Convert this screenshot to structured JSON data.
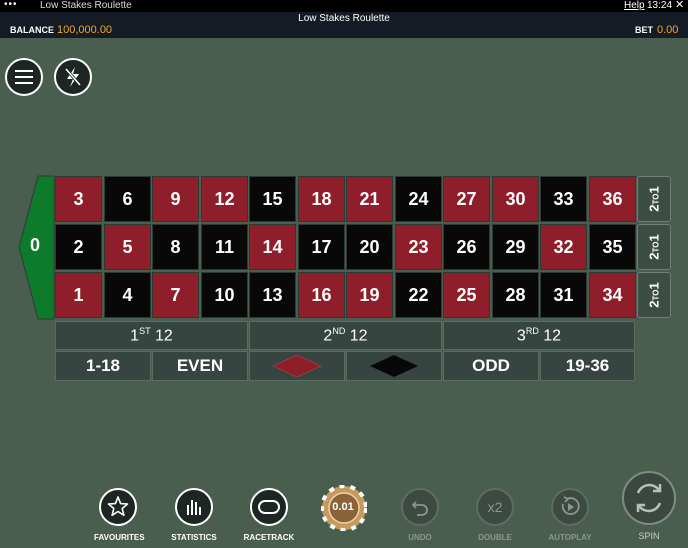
{
  "topbar": {
    "app_name": "Low Stakes Roulette",
    "help": "Help",
    "time": "13:24",
    "dots": "•••",
    "close": "✕"
  },
  "header": {
    "title": "Low Stakes Roulette",
    "balance_label": "BALANCE",
    "balance_value": "100,000.00",
    "bet_label": "BET",
    "bet_value": "0.00"
  },
  "table": {
    "zero": "0",
    "rows": [
      [
        {
          "n": "3",
          "c": "red"
        },
        {
          "n": "6",
          "c": "black"
        },
        {
          "n": "9",
          "c": "red"
        },
        {
          "n": "12",
          "c": "red"
        },
        {
          "n": "15",
          "c": "black"
        },
        {
          "n": "18",
          "c": "red"
        },
        {
          "n": "21",
          "c": "red"
        },
        {
          "n": "24",
          "c": "black"
        },
        {
          "n": "27",
          "c": "red"
        },
        {
          "n": "30",
          "c": "red"
        },
        {
          "n": "33",
          "c": "black"
        },
        {
          "n": "36",
          "c": "red"
        }
      ],
      [
        {
          "n": "2",
          "c": "black"
        },
        {
          "n": "5",
          "c": "red"
        },
        {
          "n": "8",
          "c": "black"
        },
        {
          "n": "11",
          "c": "black"
        },
        {
          "n": "14",
          "c": "red"
        },
        {
          "n": "17",
          "c": "black"
        },
        {
          "n": "20",
          "c": "black"
        },
        {
          "n": "23",
          "c": "red"
        },
        {
          "n": "26",
          "c": "black"
        },
        {
          "n": "29",
          "c": "black"
        },
        {
          "n": "32",
          "c": "red"
        },
        {
          "n": "35",
          "c": "black"
        }
      ],
      [
        {
          "n": "1",
          "c": "red"
        },
        {
          "n": "4",
          "c": "black"
        },
        {
          "n": "7",
          "c": "red"
        },
        {
          "n": "10",
          "c": "black"
        },
        {
          "n": "13",
          "c": "black"
        },
        {
          "n": "16",
          "c": "red"
        },
        {
          "n": "19",
          "c": "red"
        },
        {
          "n": "22",
          "c": "black"
        },
        {
          "n": "25",
          "c": "red"
        },
        {
          "n": "28",
          "c": "black"
        },
        {
          "n": "31",
          "c": "black"
        },
        {
          "n": "34",
          "c": "red"
        }
      ]
    ],
    "column_bets": [
      "2",
      "TO",
      "1"
    ],
    "dozens": [
      {
        "num": "1",
        "sup": "ST",
        "rest": "12"
      },
      {
        "num": "2",
        "sup": "ND",
        "rest": "12"
      },
      {
        "num": "3",
        "sup": "RD",
        "rest": "12"
      }
    ],
    "outside": {
      "low": "1-18",
      "even": "EVEN",
      "odd": "ODD",
      "high": "19-36"
    }
  },
  "controls": {
    "favourites": "FAVOURITES",
    "statistics": "STATISTICS",
    "racetrack": "RACETRACK",
    "chip": "0.01",
    "undo": "UNDO",
    "double": "DOUBLE",
    "double_icon": "x2",
    "autoplay": "AUTOPLAY",
    "spin": "SPIN"
  },
  "colors": {
    "background": "#4a5e4f",
    "red": "#8f1e2b",
    "black": "#080808",
    "zero_green": "#0e7a2c",
    "accent": "#f0a830"
  }
}
